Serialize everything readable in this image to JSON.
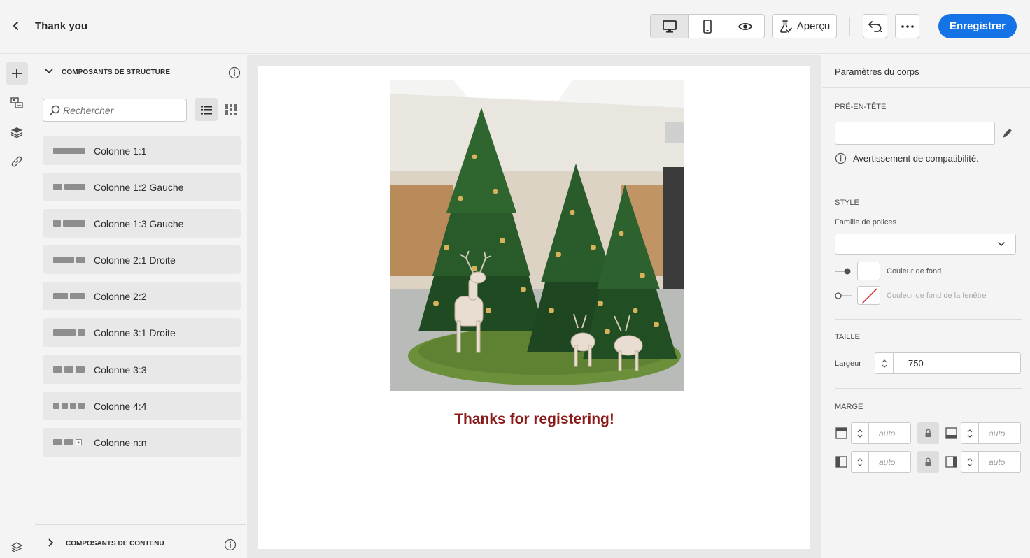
{
  "header": {
    "title": "Thank you",
    "preview_label": "Aperçu",
    "save_label": "Enregistrer"
  },
  "structure_panel": {
    "title": "COMPOSANTS DE STRUCTURE",
    "search_placeholder": "Rechercher",
    "components": [
      {
        "label": "Colonne 1:1"
      },
      {
        "label": "Colonne 1:2 Gauche"
      },
      {
        "label": "Colonne 1:3 Gauche"
      },
      {
        "label": "Colonne 2:1 Droite"
      },
      {
        "label": "Colonne 2:2"
      },
      {
        "label": "Colonne 3:1 Droite"
      },
      {
        "label": "Colonne 3:3"
      },
      {
        "label": "Colonne 4:4"
      },
      {
        "label": "Colonne n:n"
      }
    ],
    "content_section_title": "COMPOSANTS DE CONTENU"
  },
  "canvas": {
    "heading": "Thanks for registering!",
    "heading_color": "#8b1a1a"
  },
  "settings": {
    "title": "Paramètres du corps",
    "preheader_label": "PRÉ-EN-TÊTE",
    "preheader_value": "",
    "compat_warning": "Avertissement de compatibilité.",
    "style_label": "STYLE",
    "font_family_label": "Famille de polices",
    "font_family_value": "-",
    "bg_color_label": "Couleur de fond",
    "window_bg_label": "Couleur de fond de la fenêtre",
    "size_label": "TAILLE",
    "width_label": "Largeur",
    "width_value": "750",
    "margin_label": "MARGE",
    "margin_top": "auto",
    "margin_bottom": "auto",
    "margin_left": "auto",
    "margin_right": "auto"
  },
  "colors": {
    "accent": "#1473e6",
    "heading": "#8b1a1a"
  }
}
